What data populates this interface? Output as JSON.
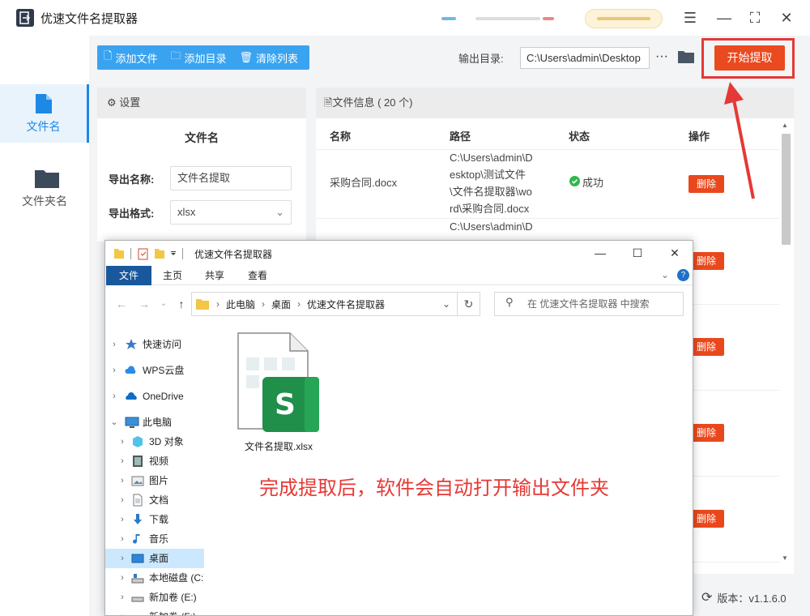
{
  "app": {
    "title": "优速文件名提取器",
    "logo_text": "E"
  },
  "sidebar": {
    "items": [
      {
        "label": "文件名",
        "icon": "file-icon",
        "active": true
      },
      {
        "label": "文件夹名",
        "icon": "folder-icon",
        "active": false
      }
    ]
  },
  "toolbar": {
    "add_file": "添加文件",
    "add_dir": "添加目录",
    "clear_list": "清除列表",
    "output_label": "输出目录:",
    "output_value": "C:\\Users\\admin\\Desktop",
    "more": "···",
    "start": "开始提取"
  },
  "settings": {
    "header": "设置",
    "section_title": "文件名",
    "export_name_label": "导出名称:",
    "export_name_value": "文件名提取",
    "export_format_label": "导出格式:",
    "export_format_value": "xlsx"
  },
  "files": {
    "header": "文件信息",
    "count": "( 20 个)",
    "columns": [
      "名称",
      "路径",
      "状态",
      "操作"
    ],
    "rows": [
      {
        "name": "采购合同.docx",
        "path_lines": [
          "C:\\Users\\admin\\D",
          "esktop\\测试文件",
          "\\文件名提取器\\wo",
          "rd\\采购合同.docx"
        ],
        "status": "成功",
        "action": "删除"
      },
      {
        "name": "",
        "path_lines": [
          "C:\\Users\\admin\\D"
        ],
        "status": "",
        "action": "删除"
      },
      {
        "name": "",
        "path_lines": [],
        "status": "",
        "action": "删除"
      },
      {
        "name": "",
        "path_lines": [],
        "status": "",
        "action": "删除"
      },
      {
        "name": "",
        "path_lines": [],
        "status": "",
        "action": "删除"
      }
    ]
  },
  "version": "版本：v1.1.6.0",
  "explorer": {
    "title": "优速文件名提取器",
    "tabs": [
      "文件",
      "主页",
      "共享",
      "查看"
    ],
    "breadcrumb": [
      "此电脑",
      "桌面",
      "优速文件名提取器"
    ],
    "search_placeholder": "在 优速文件名提取器 中搜索",
    "tree": [
      {
        "label": "快速访问",
        "icon": "star-icon",
        "level": 0
      },
      {
        "label": "WPS云盘",
        "icon": "cloud-icon",
        "level": 0
      },
      {
        "label": "OneDrive",
        "icon": "onedrive-icon",
        "level": 0
      },
      {
        "label": "此电脑",
        "icon": "computer-icon",
        "level": 0,
        "expanded": true
      },
      {
        "label": "3D 对象",
        "icon": "3d-objects-icon",
        "level": 1
      },
      {
        "label": "视频",
        "icon": "video-icon",
        "level": 1
      },
      {
        "label": "图片",
        "icon": "picture-icon",
        "level": 1
      },
      {
        "label": "文档",
        "icon": "document-icon",
        "level": 1
      },
      {
        "label": "下载",
        "icon": "download-icon",
        "level": 1
      },
      {
        "label": "音乐",
        "icon": "music-icon",
        "level": 1
      },
      {
        "label": "桌面",
        "icon": "desktop-icon",
        "level": 1,
        "selected": true
      },
      {
        "label": "本地磁盘 (C:)",
        "icon": "drive-icon",
        "level": 1
      },
      {
        "label": "新加卷 (E:)",
        "icon": "drive-icon",
        "level": 1
      },
      {
        "label": "新加卷 (F:)",
        "icon": "drive-icon",
        "level": 1
      }
    ],
    "file_name": "文件名提取.xlsx",
    "note": "完成提取后，软件会自动打开输出文件夹"
  },
  "colors": {
    "accent_blue": "#3aa3f0",
    "start_orange": "#ea4a1f",
    "highlight_red": "#e53935",
    "success_green": "#2db84d"
  }
}
